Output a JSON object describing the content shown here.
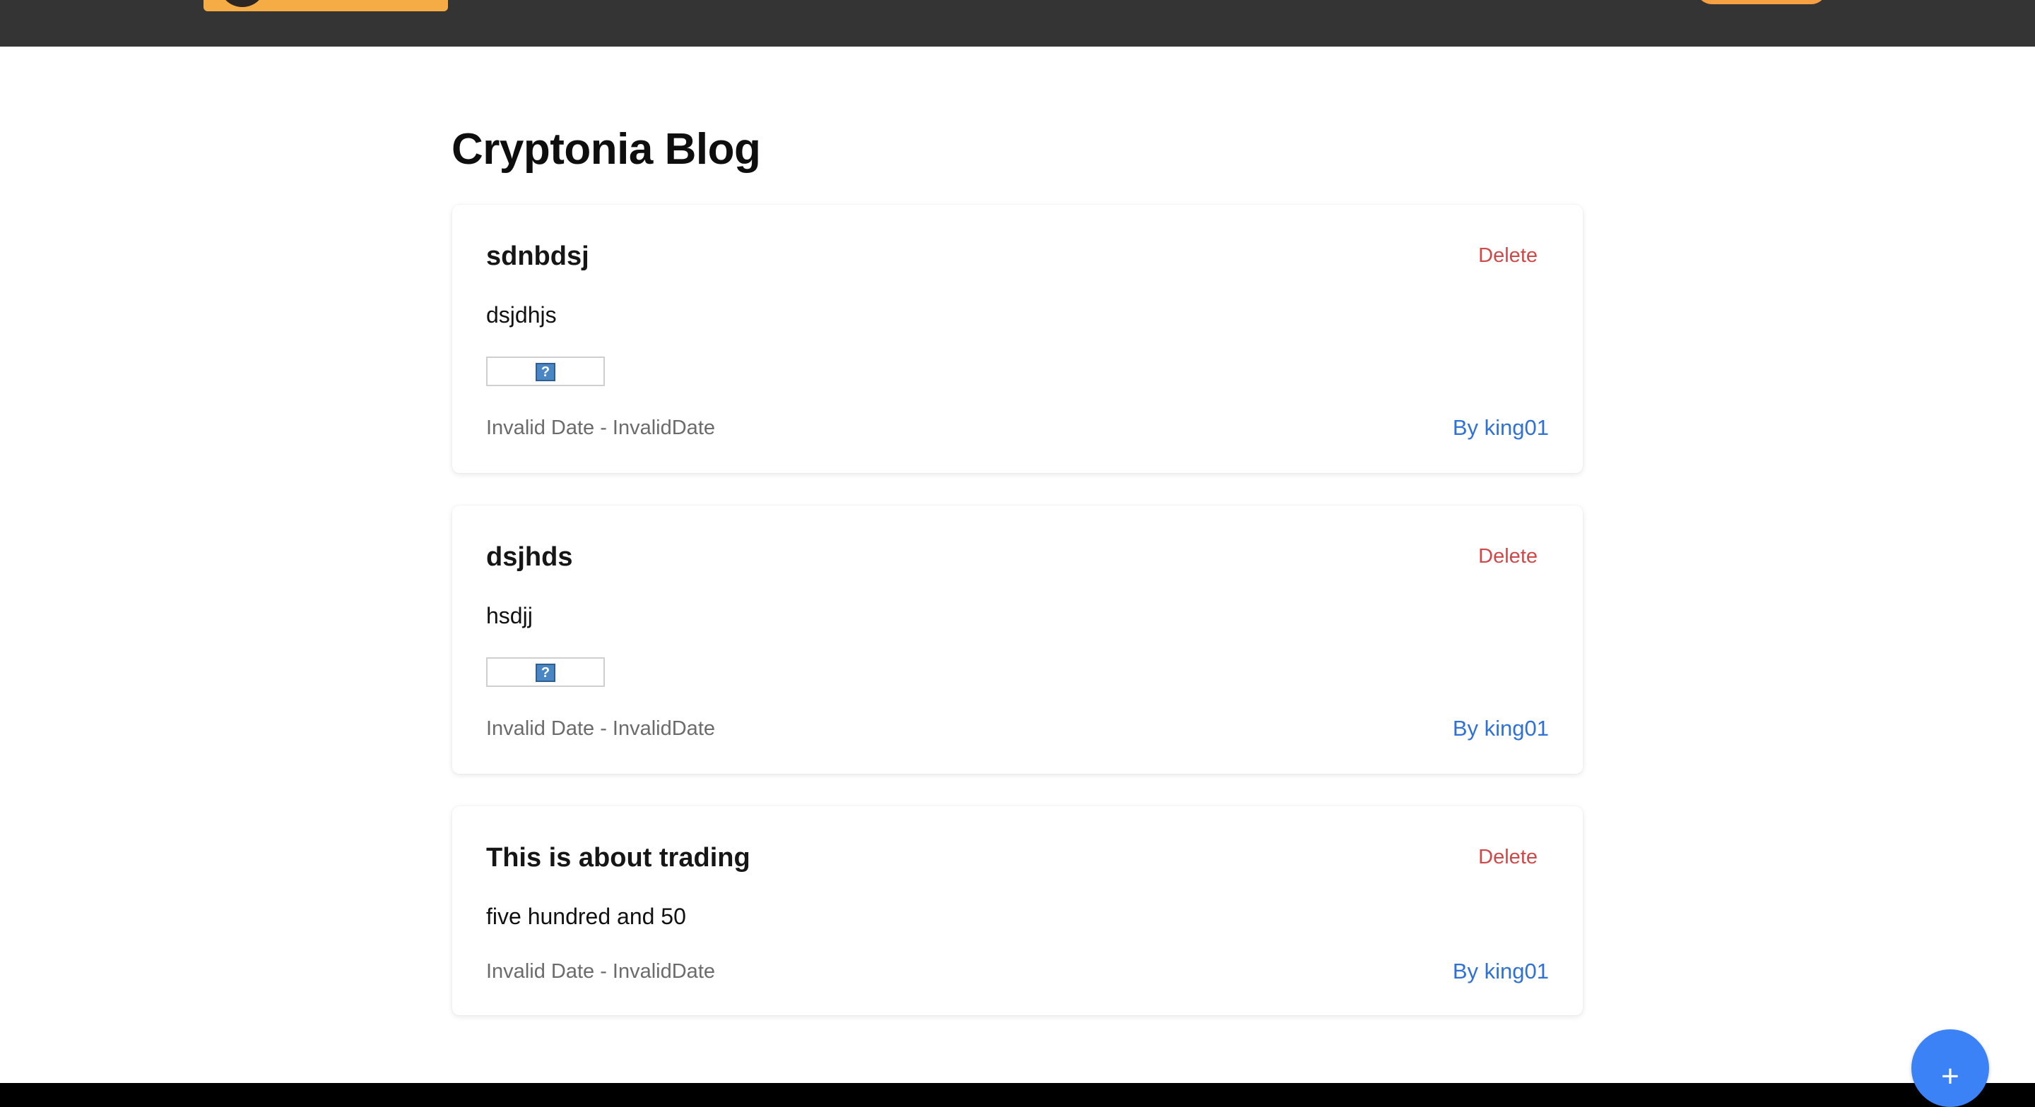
{
  "header": {
    "brand_color": "#f5ac45",
    "bar_color": "#353435"
  },
  "page": {
    "title": "Cryptonia Blog"
  },
  "posts": [
    {
      "title": "sdnbdsj",
      "delete_label": "Delete",
      "body": "dsjdhjs",
      "has_image": true,
      "image_icon": "?",
      "date": "Invalid Date - InvalidDate",
      "author": "By king01"
    },
    {
      "title": "dsjhds",
      "delete_label": "Delete",
      "body": "hsdjj",
      "has_image": true,
      "image_icon": "?",
      "date": "Invalid Date - InvalidDate",
      "author": "By king01"
    },
    {
      "title": "This is about trading",
      "delete_label": "Delete",
      "body": "five hundred and 50",
      "has_image": false,
      "date": "Invalid Date - InvalidDate",
      "author": "By king01"
    }
  ],
  "fab": {
    "label": "+",
    "color": "#3b82f6"
  },
  "colors": {
    "delete": "#d04848",
    "author_link": "#2f72d6"
  }
}
